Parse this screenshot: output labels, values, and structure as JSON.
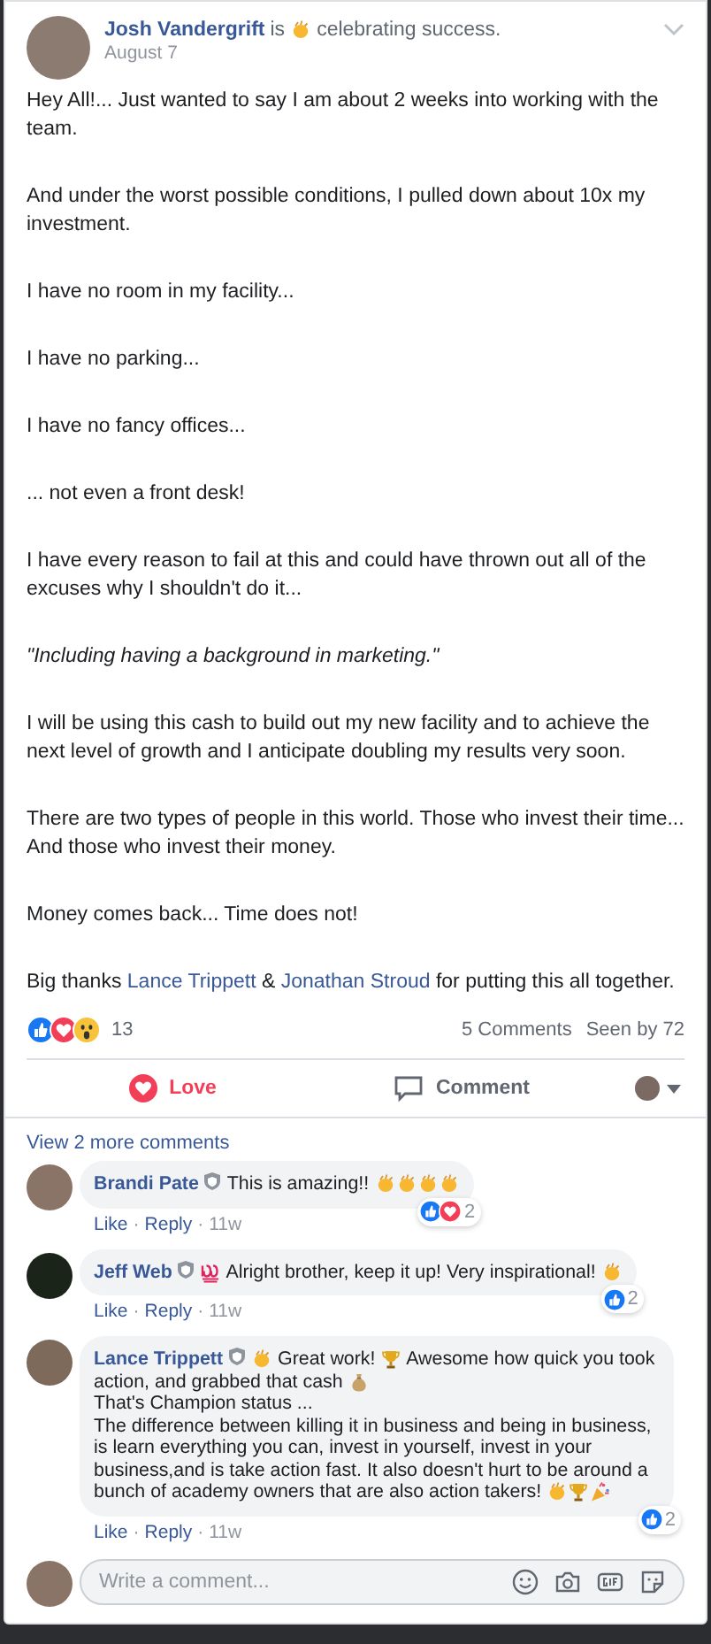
{
  "post": {
    "author": "Josh Vandergrift",
    "verb": "is",
    "activity": "celebrating success.",
    "date": "August 7",
    "paragraphs": [
      {
        "kind": "plain",
        "text": "Hey All!... Just wanted to say I am about 2 weeks into working with the team."
      },
      {
        "kind": "plain",
        "text": "And under the worst possible conditions, I pulled down about 10x my investment."
      },
      {
        "kind": "plain",
        "text": "I have no room in my facility..."
      },
      {
        "kind": "plain",
        "text": "I have no parking..."
      },
      {
        "kind": "plain",
        "text": "I have no fancy offices..."
      },
      {
        "kind": "plain",
        "text": "... not even a front desk!"
      },
      {
        "kind": "plain",
        "text": "I have every reason to fail at this and could have thrown out all of the excuses why I shouldn't do it..."
      },
      {
        "kind": "italic",
        "text": "\"Including having a background in marketing.\""
      },
      {
        "kind": "plain",
        "text": "I will be using this cash to build out my new facility and to achieve the next level of growth and I anticipate doubling my results very soon."
      },
      {
        "kind": "plain",
        "text": "There are two types of people in this world. Those who invest their time...\nAnd those who invest their money."
      },
      {
        "kind": "plain",
        "text": "Money comes back... Time does not!"
      },
      {
        "kind": "mentions",
        "parts": [
          {
            "kind": "text",
            "text": "Big thanks "
          },
          {
            "kind": "link",
            "text": "Lance Trippett"
          },
          {
            "kind": "text",
            "text": " & "
          },
          {
            "kind": "link",
            "text": "Jonathan Stroud"
          },
          {
            "kind": "text",
            "text": " for putting this all together."
          }
        ]
      }
    ],
    "reactions": [
      {
        "kind": "like"
      },
      {
        "kind": "love"
      },
      {
        "kind": "wow"
      }
    ],
    "reaction_count": "13",
    "comments_count": "5 Comments",
    "seen_by": "Seen by 72",
    "actions": [
      {
        "kind": "love",
        "label": "Love",
        "selected": true
      },
      {
        "kind": "comment",
        "label": "Comment",
        "selected": false
      }
    ]
  },
  "comments_section": {
    "view_more": "View 2 more comments",
    "comments": [
      {
        "author": "Brandi Pate",
        "segments": [
          {
            "kind": "text",
            "text": "This is amazing!! "
          },
          {
            "kind": "clap"
          },
          {
            "kind": "clap"
          },
          {
            "kind": "clap"
          },
          {
            "kind": "clap"
          }
        ],
        "reactions": [
          {
            "kind": "like"
          },
          {
            "kind": "love"
          }
        ],
        "reaction_count": "2",
        "actions": [
          {
            "kind": "link",
            "text": "Like"
          },
          {
            "kind": "separator",
            "text": "·"
          },
          {
            "kind": "link",
            "text": "Reply"
          },
          {
            "kind": "separator",
            "text": "·"
          },
          {
            "kind": "time",
            "text": "11w"
          }
        ]
      },
      {
        "author": "Jeff Web",
        "segments": [
          {
            "kind": "hundred"
          },
          {
            "kind": "text",
            "text": " Alright brother, keep it up! Very inspirational! "
          },
          {
            "kind": "clap"
          }
        ],
        "reactions": [
          {
            "kind": "like"
          }
        ],
        "reaction_count": "2",
        "actions": [
          {
            "kind": "link",
            "text": "Like"
          },
          {
            "kind": "separator",
            "text": "·"
          },
          {
            "kind": "link",
            "text": "Reply"
          },
          {
            "kind": "separator",
            "text": "·"
          },
          {
            "kind": "time",
            "text": "11w"
          }
        ]
      },
      {
        "author": "Lance Trippett",
        "segments": [
          {
            "kind": "clap"
          },
          {
            "kind": "text",
            "text": " Great work! "
          },
          {
            "kind": "trophy"
          },
          {
            "kind": "text",
            "text": " Awesome how quick you took action, and grabbed that cash "
          },
          {
            "kind": "moneybag"
          },
          {
            "kind": "text",
            "text": "\nThat's Champion status ...\nThe difference between killing it in business and being in business, is learn everything you can, invest in yourself, invest in your business,and is take action fast. It also doesn't hurt to be around a bunch of academy owners that are also action takers! "
          },
          {
            "kind": "clap"
          },
          {
            "kind": "trophy"
          },
          {
            "kind": "party"
          }
        ],
        "reactions": [
          {
            "kind": "like"
          }
        ],
        "reaction_count": "2",
        "actions": [
          {
            "kind": "link",
            "text": "Like"
          },
          {
            "kind": "separator",
            "text": "·"
          },
          {
            "kind": "link",
            "text": "Reply"
          },
          {
            "kind": "separator",
            "text": "·"
          },
          {
            "kind": "time",
            "text": "11w"
          }
        ]
      }
    ],
    "composer": {
      "placeholder": "Write a comment..."
    }
  }
}
